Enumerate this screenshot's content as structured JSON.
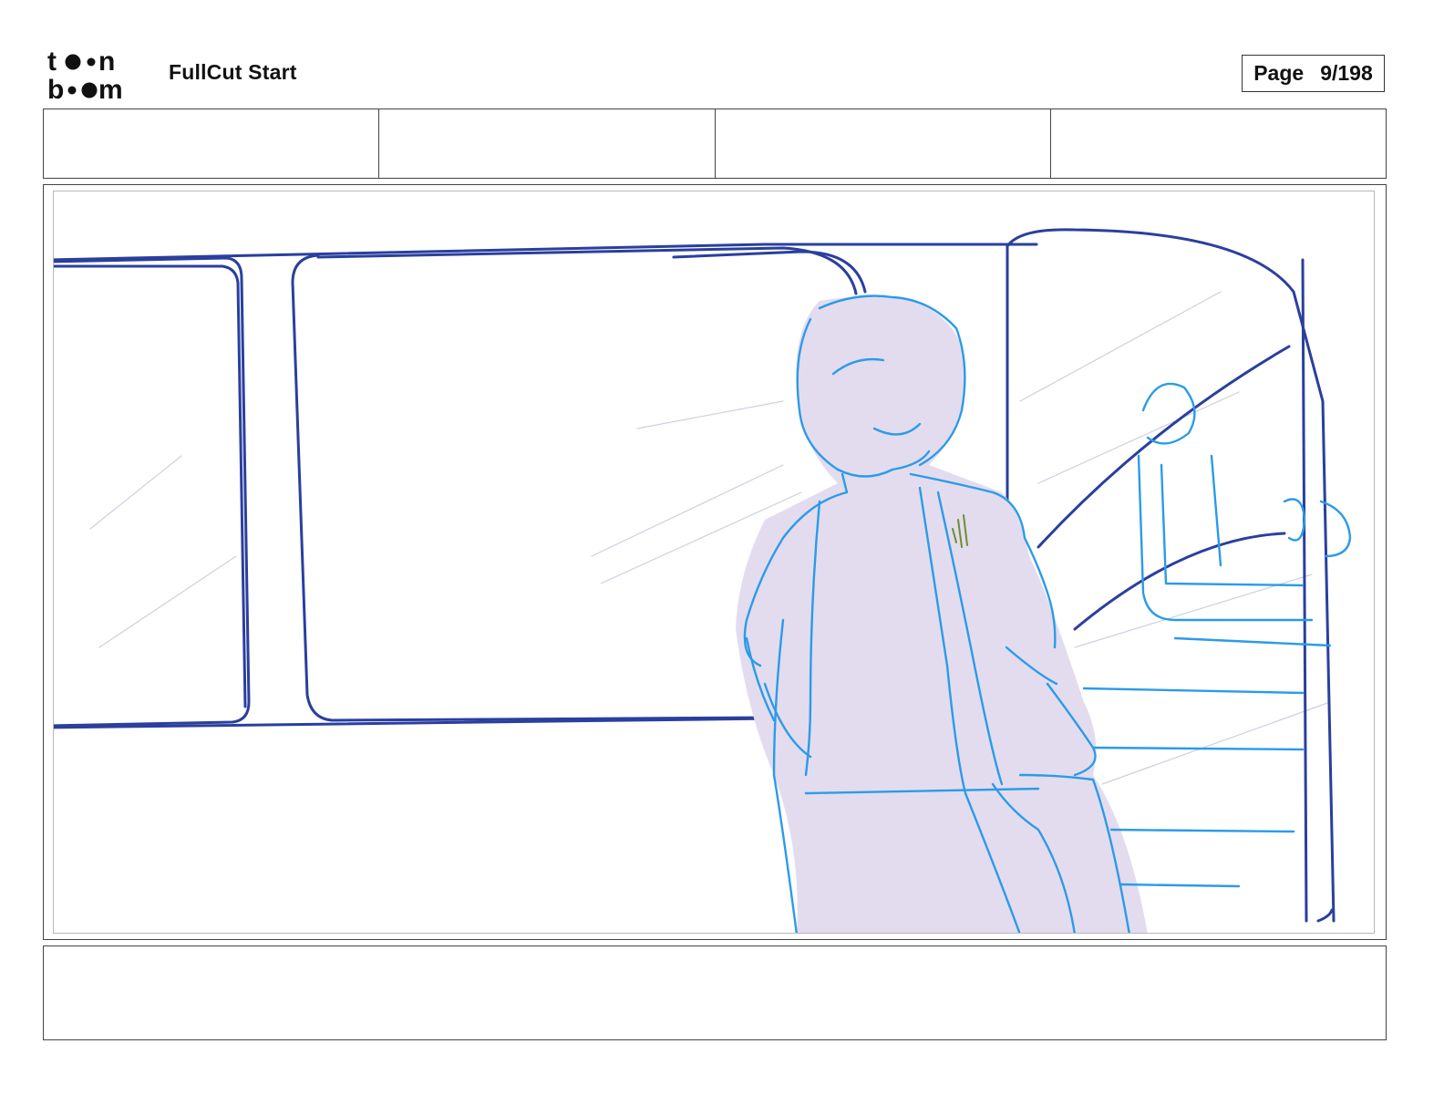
{
  "header": {
    "logo_text": "toon boom",
    "project_title": "FullCut Start",
    "page_label": "Page",
    "page_number": "9/198"
  },
  "info_cells": [
    "",
    "",
    "",
    ""
  ],
  "panel": {
    "image_description_icon": "storyboard-sketch",
    "colors": {
      "dark_line": "#2a3f9e",
      "light_line": "#2b9be8",
      "fill": "#e3dcef",
      "faint": "#c9cede",
      "accent": "#6b8f2e"
    }
  },
  "notes": ""
}
